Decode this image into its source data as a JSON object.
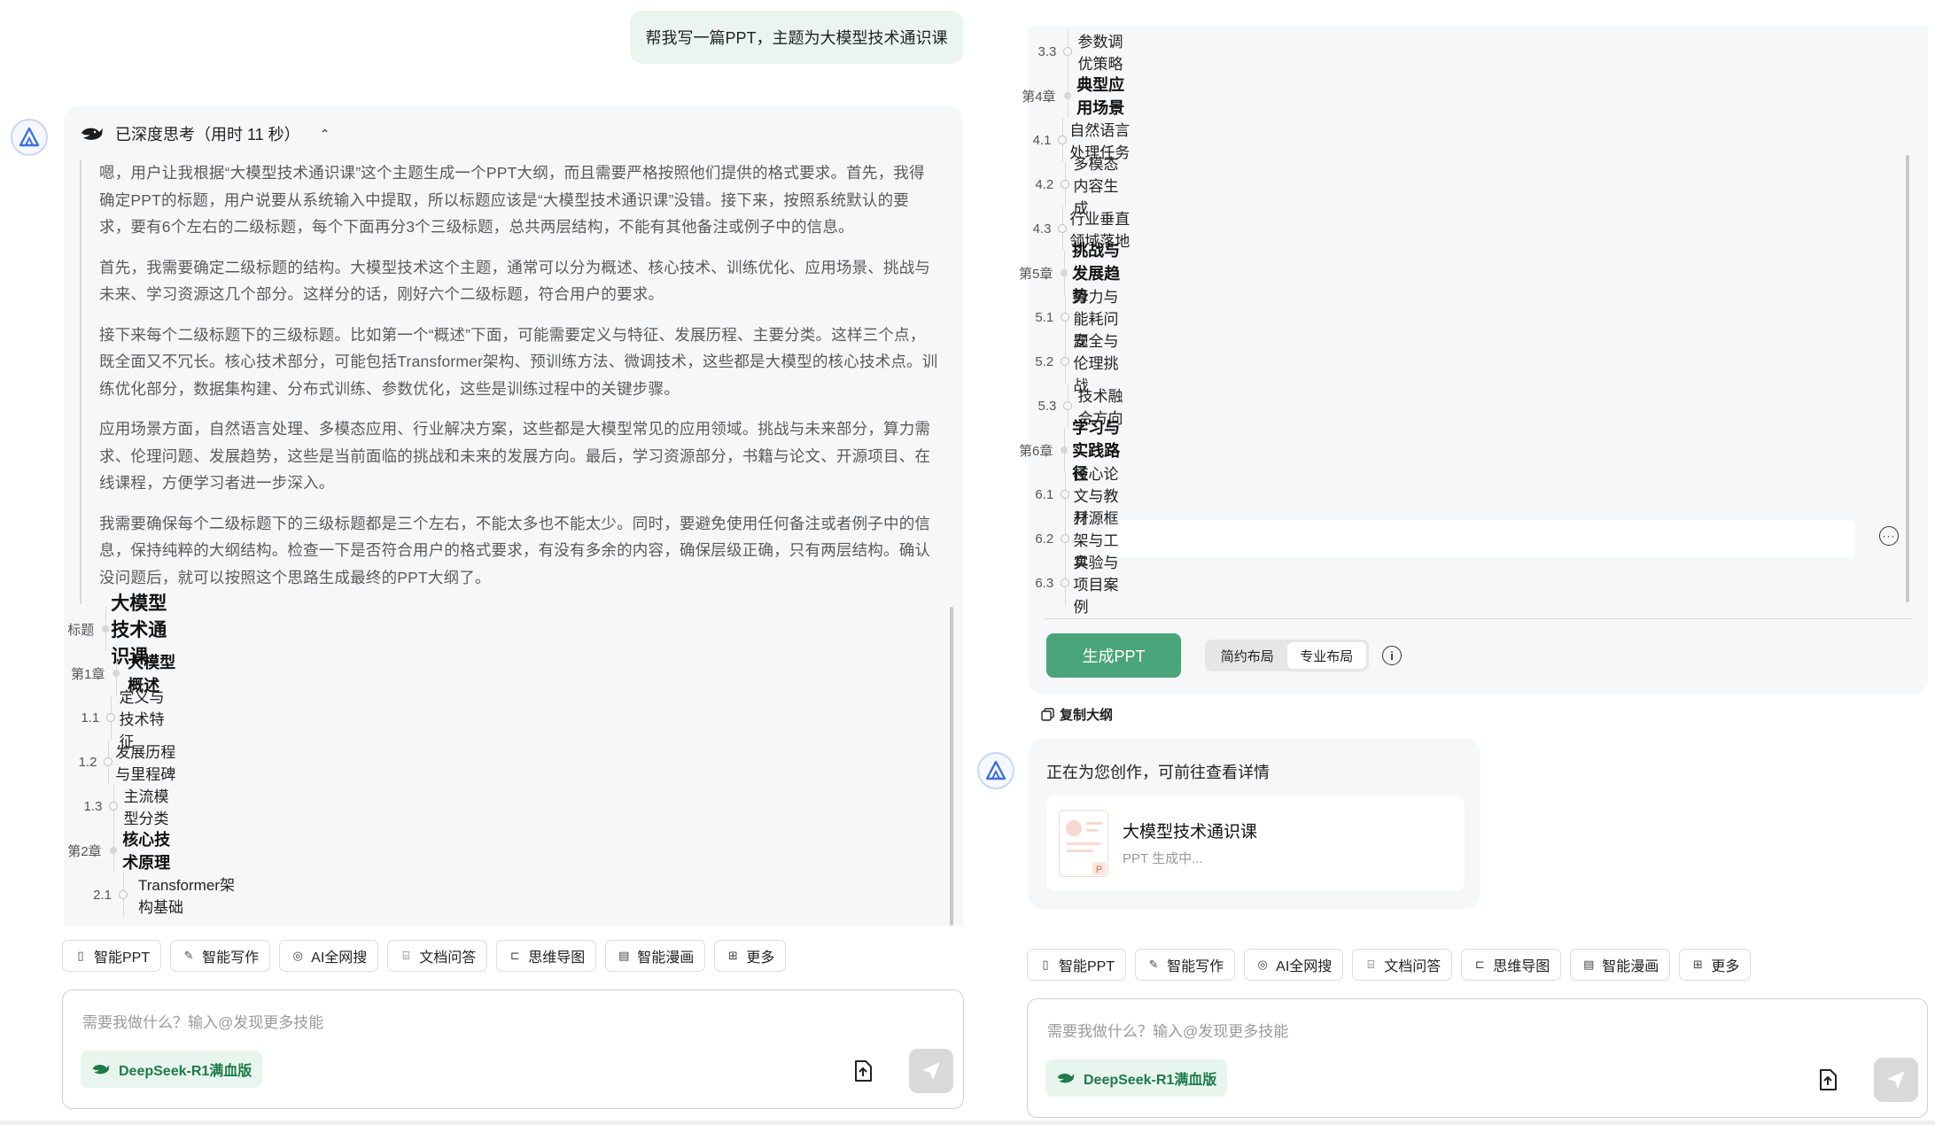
{
  "user_message": "帮我写一篇PPT，主题为大模型技术通识课",
  "thinking": {
    "header": "已深度思考（用时 11 秒）",
    "paragraphs": [
      [
        "嗯，用户让我根据“大模型技术通识课”这个主题生成一个PPT大纲，而且需要严格按照他们提供的格式要求。首先，我得",
        "确定PPT的标题，用户说要从系统输入中提取，所以标题应该是“大模型技术通识课”没错。接下来，按照系统默认的要",
        "求，要有6个左右的二级标题，每个下面再分3个三级标题，总共两层结构，不能有其他备注或例子中的信息。"
      ],
      [
        "首先，我需要确定二级标题的结构。大模型技术这个主题，通常可以分为概述、核心技术、训练优化、应用场景、挑战与",
        "未来、学习资源这几个部分。这样分的话，刚好六个二级标题，符合用户的要求。"
      ],
      [
        "接下来每个二级标题下的三级标题。比如第一个“概述”下面，可能需要定义与特征、发展历程、主要分类。这样三个点，",
        "既全面又不冗长。核心技术部分，可能包括Transformer架构、预训练方法、微调技术，这些都是大模型的核心技术点。训",
        "练优化部分，数据集构建、分布式训练、参数优化，这些是训练过程中的关键步骤。"
      ],
      [
        "应用场景方面，自然语言处理、多模态应用、行业解决方案，这些都是大模型常见的应用领域。挑战与未来部分，算力需",
        "求、伦理问题、发展趋势，这些是当前面临的挑战和未来的发展方向。最后，学习资源部分，书籍与论文、开源项目、在",
        "线课程，方便学习者进一步深入。"
      ],
      [
        "我需要确保每个二级标题下的三级标题都是三个左右，不能太多也不能太少。同时，要避免使用任何备注或者例子中的信",
        "息，保持纯粹的大纲结构。检查一下是否符合用户的格式要求，有没有多余的内容，确保层级正确，只有两层结构。确认",
        "没问题后，就可以按照这个思路生成最终的PPT大纲了。"
      ]
    ]
  },
  "outline_left": [
    {
      "num": "标题",
      "text": "大模型技术通识课",
      "level": "title"
    },
    {
      "num": "第1章",
      "text": "大模型概述",
      "level": "chapter"
    },
    {
      "num": "1.1",
      "text": "定义与技术特征",
      "level": "item"
    },
    {
      "num": "1.2",
      "text": "发展历程与里程碑",
      "level": "item"
    },
    {
      "num": "1.3",
      "text": "主流模型分类",
      "level": "item"
    },
    {
      "num": "第2章",
      "text": "核心技术原理",
      "level": "chapter"
    },
    {
      "num": "2.1",
      "text": "Transformer架构基础",
      "level": "item"
    }
  ],
  "outline_right": [
    {
      "num": "3.3",
      "text": "参数调优策略",
      "level": "item"
    },
    {
      "num": "第4章",
      "text": "典型应用场景",
      "level": "chapter"
    },
    {
      "num": "4.1",
      "text": "自然语言处理任务",
      "level": "item"
    },
    {
      "num": "4.2",
      "text": "多模态内容生成",
      "level": "item"
    },
    {
      "num": "4.3",
      "text": "行业垂直领域落地",
      "level": "item"
    },
    {
      "num": "第5章",
      "text": "挑战与发展趋势",
      "level": "chapter"
    },
    {
      "num": "5.1",
      "text": "算力与能耗问题",
      "level": "item"
    },
    {
      "num": "5.2",
      "text": "安全与伦理挑战",
      "level": "item"
    },
    {
      "num": "5.3",
      "text": "技术融合方向",
      "level": "item"
    },
    {
      "num": "第6章",
      "text": "学习与实践路径",
      "level": "chapter"
    },
    {
      "num": "6.1",
      "text": "核心论文与教材",
      "level": "item"
    },
    {
      "num": "6.2",
      "text": "开源框架与工具",
      "level": "item"
    },
    {
      "num": "6.3",
      "text": "实验与项目案例",
      "level": "item"
    }
  ],
  "tools": [
    "智能PPT",
    "智能写作",
    "AI全网搜",
    "文档问答",
    "思维导图",
    "智能漫画",
    "更多"
  ],
  "input": {
    "placeholder": "需要我做什么？输入@发现更多技能",
    "model": "DeepSeek-R1满血版"
  },
  "actions": {
    "generate": "生成PPT",
    "layout_simple": "简约布局",
    "layout_pro": "专业布局",
    "copy_outline": "复制大纲"
  },
  "status": {
    "text": "正在为您创作，可前往查看详情",
    "doc_title": "大模型技术通识课",
    "doc_sub": "PPT 生成中..."
  },
  "colors": {
    "accent": "#4aa57a",
    "bubble": "#eaf5ef",
    "card": "#f6f7f8"
  }
}
